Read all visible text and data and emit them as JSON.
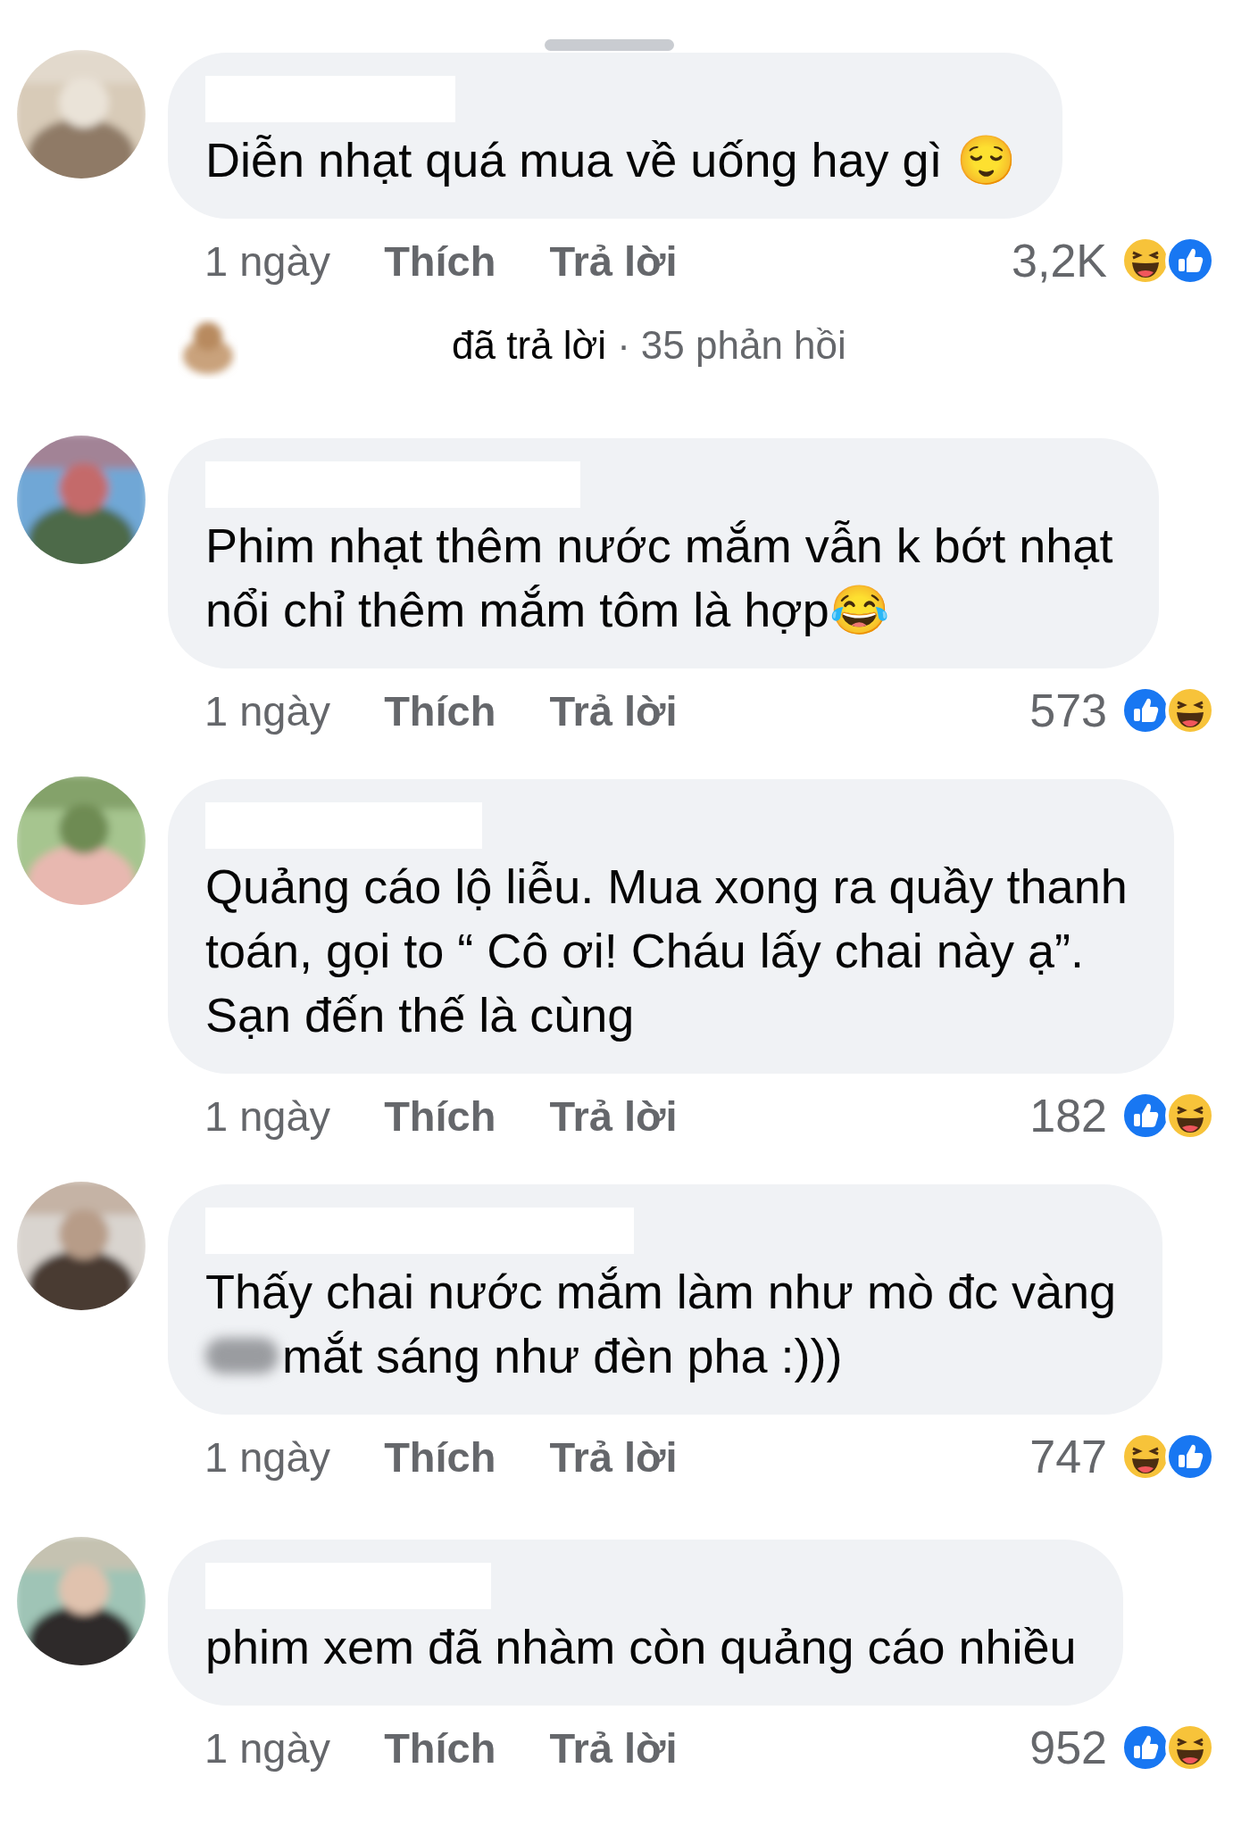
{
  "comments": [
    {
      "lines": [
        {
          "text": "Diễn nhạt quá mua về uống hay gì 😌"
        }
      ],
      "time": "1 ngày",
      "like": "Thích",
      "reply": "Trả lời",
      "count": "3,2K",
      "reactions": [
        {
          "kind": "haha"
        },
        {
          "kind": "like"
        }
      ],
      "replies": {
        "label": "đã trả lời",
        "separator": "·",
        "count": "35 phản hồi"
      }
    },
    {
      "lines": [
        {
          "text": "Phim nhạt thêm nước mắm vẫn k bớt nhạt"
        },
        {
          "text": "nổi chỉ thêm mắm tôm là hợp😂"
        }
      ],
      "time": "1 ngày",
      "like": "Thích",
      "reply": "Trả lời",
      "count": "573",
      "reactions": [
        {
          "kind": "like"
        },
        {
          "kind": "haha"
        }
      ]
    },
    {
      "lines": [
        {
          "text": "Quảng cáo lộ liễu. Mua xong ra quầy thanh"
        },
        {
          "text": "toán, gọi to “ Cô ơi! Cháu lấy chai này ạ”."
        },
        {
          "text": "Sạn đến thế là cùng"
        }
      ],
      "time": "1 ngày",
      "like": "Thích",
      "reply": "Trả lời",
      "count": "182",
      "reactions": [
        {
          "kind": "like"
        },
        {
          "kind": "haha"
        }
      ]
    },
    {
      "lines": [
        {
          "text": "Thấy chai nước mắm làm như mò đc vàng"
        },
        {
          "text": "mắt sáng như đèn pha :)))",
          "blurred": true
        }
      ],
      "time": "1 ngày",
      "like": "Thích",
      "reply": "Trả lời",
      "count": "747",
      "reactions": [
        {
          "kind": "haha"
        },
        {
          "kind": "like"
        }
      ]
    },
    {
      "lines": [
        {
          "text": "phim xem đã nhàm còn quảng cáo nhiều"
        }
      ],
      "time": "1 ngày",
      "like": "Thích",
      "reply": "Trả lời",
      "count": "952",
      "reactions": [
        {
          "kind": "like"
        },
        {
          "kind": "haha"
        }
      ]
    }
  ]
}
